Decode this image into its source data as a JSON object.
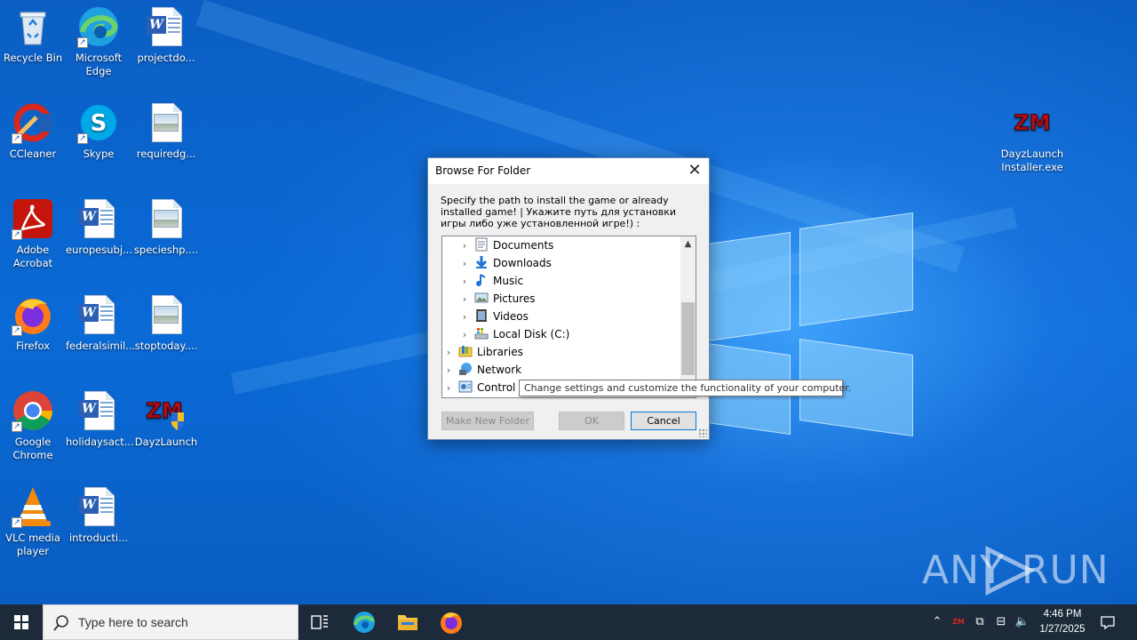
{
  "desktop": {
    "icons": [
      {
        "label": "Recycle Bin",
        "icon": "recycle-bin-icon"
      },
      {
        "label": "Microsoft Edge",
        "icon": "edge-icon"
      },
      {
        "label": "projectdo...",
        "icon": "word-doc-icon"
      },
      {
        "label": "CCleaner",
        "icon": "ccleaner-icon"
      },
      {
        "label": "Skype",
        "icon": "skype-icon"
      },
      {
        "label": "requiredg...",
        "icon": "image-file-icon"
      },
      {
        "label": "Adobe Acrobat",
        "icon": "acrobat-icon"
      },
      {
        "label": "europesubj...",
        "icon": "word-doc-icon"
      },
      {
        "label": "specieshp....",
        "icon": "image-file-icon"
      },
      {
        "label": "Firefox",
        "icon": "firefox-icon"
      },
      {
        "label": "federalsimil...",
        "icon": "word-doc-icon"
      },
      {
        "label": "stoptoday....",
        "icon": "image-file-icon"
      },
      {
        "label": "Google Chrome",
        "icon": "chrome-icon"
      },
      {
        "label": "holidaysact...",
        "icon": "word-doc-icon"
      },
      {
        "label": "DayzLaunch",
        "icon": "dayzlaunch-icon"
      },
      {
        "label": "VLC media player",
        "icon": "vlc-icon"
      },
      {
        "label": "introducti...",
        "icon": "word-doc-icon"
      },
      {
        "label": "DayzLaunch Installer.exe",
        "icon": "dayzlaunch-icon"
      }
    ]
  },
  "dialog": {
    "title": "Browse For Folder",
    "description": "Specify the path to install the game or already installed game! | Укажите путь для установки игры либо уже установленной игре!) :",
    "tree": [
      {
        "label": "Documents",
        "icon": "documents-icon"
      },
      {
        "label": "Downloads",
        "icon": "downloads-icon"
      },
      {
        "label": "Music",
        "icon": "music-icon"
      },
      {
        "label": "Pictures",
        "icon": "pictures-icon"
      },
      {
        "label": "Videos",
        "icon": "videos-icon"
      },
      {
        "label": "Local Disk (C:)",
        "icon": "local-disk-icon"
      },
      {
        "label": "Libraries",
        "icon": "libraries-icon"
      },
      {
        "label": "Network",
        "icon": "network-icon"
      },
      {
        "label": "Control P",
        "icon": "control-panel-icon"
      }
    ],
    "buttons": {
      "make_new_folder": "Make New Folder",
      "ok": "OK",
      "cancel": "Cancel"
    },
    "tooltip": "Change settings and customize the functionality of your computer."
  },
  "watermark": {
    "text_left": "ANY",
    "text_right": "RUN"
  },
  "taskbar": {
    "search_placeholder": "Type here to search",
    "clock_time": "4:46 PM",
    "clock_date": "1/27/2025"
  },
  "colors": {
    "desktop_blue": "#0a63c9",
    "taskbar": "#1c2a3a",
    "dialog_bg": "#f0f0f0"
  }
}
